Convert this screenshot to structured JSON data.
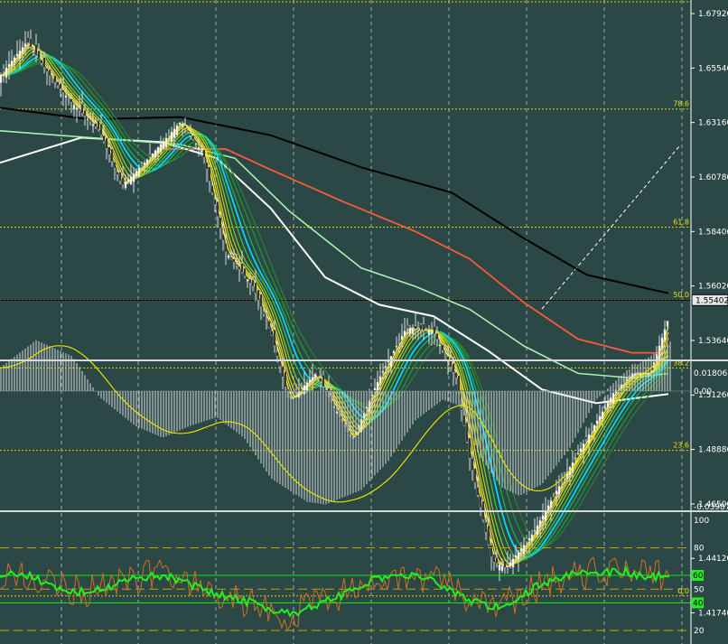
{
  "chart_data": [
    {
      "type": "candlestick",
      "title": "",
      "price_ticks": [
        "1.67920",
        "1.65540",
        "1.63160",
        "1.60780",
        "1.58400",
        "1.56020",
        "1.53640",
        "1.51260",
        "1.48880",
        "1.46500",
        "1.44120",
        "1.41740"
      ],
      "price_range": [
        1.4174,
        1.6912
      ],
      "current_price": "1.55402",
      "fib_levels": [
        {
          "label": "78.6",
          "price": 1.6375
        },
        {
          "label": "61.8",
          "price": 1.5859
        },
        {
          "label": "50.0",
          "price": 1.5542
        },
        {
          "label": "38.2",
          "price": 1.5244
        },
        {
          "label": "23.6",
          "price": 1.4884
        },
        {
          "label": "0.0",
          "price": 1.4248
        }
      ],
      "ma_colors": [
        "#000000",
        "#ff5a3a",
        "#ffffff",
        "#a8f0b0",
        "#00ffff",
        "#22aa22",
        "#ffff00",
        "#ffcc33"
      ]
    },
    {
      "type": "bar",
      "title": "",
      "ticks": [
        "0.018061",
        "0.00",
        "-0.03987"
      ],
      "ylim": [
        -0.03987,
        0.018061
      ]
    },
    {
      "type": "line",
      "title": "",
      "ticks": [
        "100",
        "80",
        "50",
        "20"
      ],
      "ylim": [
        12,
        100
      ],
      "levels": [
        {
          "label": "80",
          "value": 80,
          "style": "dashed",
          "color": "#c8a000"
        },
        {
          "label": "60",
          "value": 60,
          "style": "solid",
          "color": "#00ee00",
          "badge": true
        },
        {
          "label": "50",
          "value": 50,
          "style": "dashed",
          "color": "#c8a000"
        },
        {
          "label": "40",
          "value": 40,
          "style": "solid",
          "color": "#00ee00",
          "badge": true
        },
        {
          "value": 20,
          "style": "dashed",
          "color": "#c8a000"
        }
      ]
    }
  ]
}
